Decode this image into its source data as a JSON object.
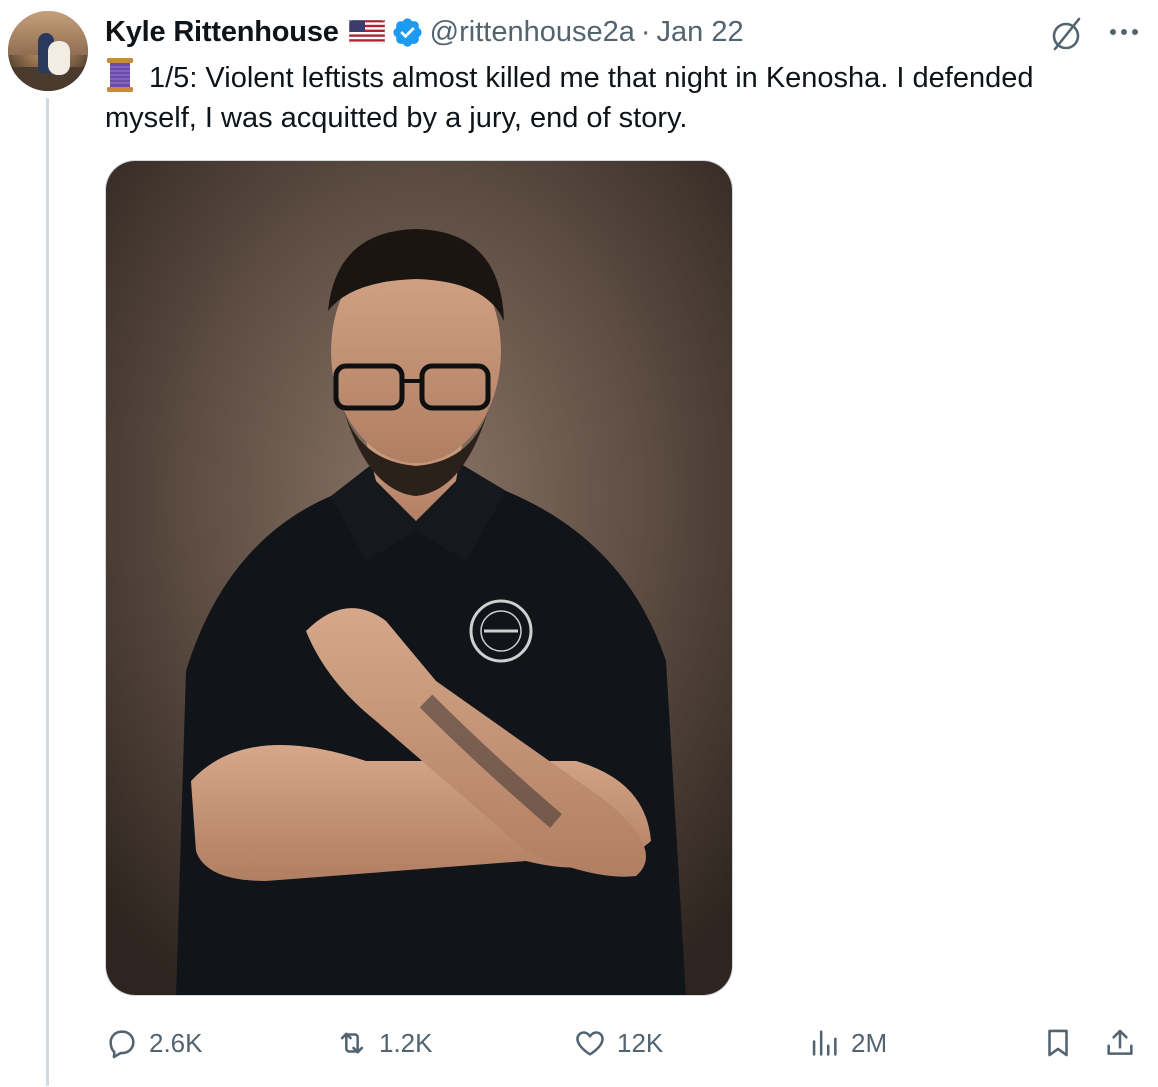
{
  "tweet": {
    "author_name": "Kyle Rittenhouse",
    "handle": "@rittenhouse2a",
    "separator": "·",
    "date": "Jan 22",
    "text": "1/5: Violent leftists almost killed me that night in Kenosha. I defended myself, I was acquitted by a jury, end of story.",
    "text_prefix_icon": "thread-spool-emoji",
    "author_badges": [
      "us-flag-emoji",
      "verified-badge-icon"
    ],
    "media_description_icon": "photo"
  },
  "header_icons": {
    "grok": "grok-icon",
    "more": "more-icon"
  },
  "actions": {
    "replies": "2.6K",
    "reposts": "1.2K",
    "likes": "12K",
    "views": "2M",
    "icons": [
      "reply-icon",
      "repost-icon",
      "like-icon",
      "views-icon",
      "bookmark-icon",
      "share-icon"
    ]
  },
  "colors": {
    "text": "#0f1419",
    "secondary": "#536471",
    "verified": "#1d9bf0",
    "thread_line": "#cfd9de"
  }
}
